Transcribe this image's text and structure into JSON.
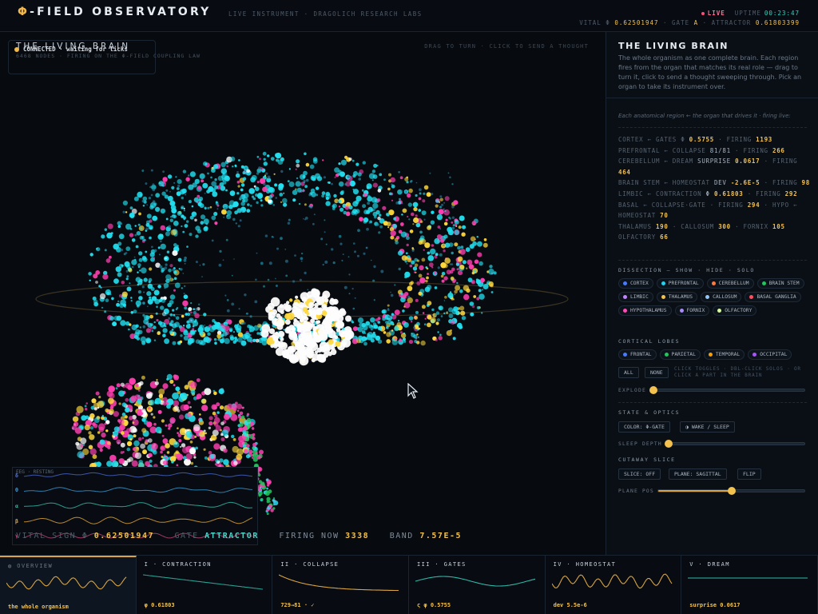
{
  "header": {
    "logo_symbol": "Φ",
    "logo_text": "-FIELD OBSERVATORY",
    "subtitle": "LIVE INSTRUMENT · DRAGOLICH RESEARCH LABS",
    "live_label": "LIVE",
    "uptime_label": "UPTIME",
    "uptime_value": "00:23:47",
    "vital_label": "VITAL Φ",
    "vital_value": "0.62501947",
    "gate_label": "· GATE",
    "gate_value": "A",
    "attractor_label": "· ATTRACTOR",
    "attractor_value": "0.61803399"
  },
  "viewport": {
    "title": "THE LIVING BRAIN",
    "connection_status": "CONNECTED · waiting for ticks",
    "nodes_text": "6468 NODES · FIRING ON THE Φ-FIELD COUPLING LAW",
    "drag_hint": "DRAG TO TURN · CLICK TO SEND A THOUGHT",
    "eeg_label": "EEG · RESTING",
    "eeg_letters": [
      "δ",
      "θ",
      "α",
      "β",
      "γ"
    ],
    "vital_sign_label": "VITAL SIGN Φ",
    "vital_sign_value": "0.62501947",
    "gate_label": "GATE",
    "gate_value": "ATTRACTOR",
    "firing_label": "FIRING NOW",
    "firing_value": "3338",
    "band_label": "BAND",
    "band_value": "7.57E-5"
  },
  "panel": {
    "title": "THE LIVING BRAIN",
    "description": "The whole organism as one complete brain. Each region fires from the organ that matches its real role — drag to turn it, click to send a thought sweeping through. Pick an organ to take its instrument over.",
    "note": "Each anatomical region ← the organ that drives it · firing live:",
    "metrics": {
      "cortex": "CORTEX ← GATES Φ",
      "cortex_phi": "0.5755",
      "cortex_firing_label": "· FIRING",
      "cortex_firing": "1193",
      "prefrontal": "PREFRONTAL ← COLLAPSE",
      "prefrontal_val": "81/81",
      "prefrontal_firing_label": "· FIRING",
      "prefrontal_firing": "266",
      "cerebellum": "CEREBELLUM ← DREAM",
      "cerebellum_surprise_label": "SURPRISE",
      "cerebellum_surprise": "0.0617",
      "cerebellum_firing_label": "· FIRING",
      "cerebellum_firing": "464",
      "brainstem": "BRAIN STEM ← HOMEOSTAT",
      "brainstem_dev_label": "DEV",
      "brainstem_dev": "-2.6E-5",
      "brainstem_firing_label": "· FIRING",
      "brainstem_firing": "98",
      "limbic": "LIMBIC ← CONTRACTION",
      "limbic_phi_label": "Φ",
      "limbic_phi": "0.61803",
      "limbic_firing_label": "· FIRING",
      "limbic_firing": "292",
      "basal": "BASAL ← COLLAPSE·GATE · FIRING",
      "basal_firing": "294",
      "hypo": "HYPO ←",
      "hypo_homeostat": "HOMEOSTAT",
      "hypo_val": "70",
      "thalamus_label": "THALAMUS",
      "thalamus_val": "190",
      "callosum_label": "CALLOSUM",
      "callosum_val": "300",
      "fornix_label": "FORNIX",
      "fornix_val": "105",
      "olfactory_label": "OLFACTORY",
      "olfactory_val": "66"
    },
    "dissection_title": "DISSECTION — SHOW · HIDE · SOLO",
    "regions": [
      {
        "label": "CORTEX",
        "color": "#4a7bff"
      },
      {
        "label": "PREFRONTAL",
        "color": "#22d3ee"
      },
      {
        "label": "CEREBELLUM",
        "color": "#ff7a3d"
      },
      {
        "label": "BRAIN STEM",
        "color": "#22c55e"
      },
      {
        "label": "LIMBIC",
        "color": "#c084fc"
      },
      {
        "label": "THALAMUS",
        "color": "#f2c14e"
      },
      {
        "label": "CALLOSUM",
        "color": "#93c5fd"
      },
      {
        "label": "BASAL GANGLIA",
        "color": "#ff4d5e"
      },
      {
        "label": "HYPOTHALAMUS",
        "color": "#ff4db8"
      },
      {
        "label": "FORNIX",
        "color": "#a78bfa"
      },
      {
        "label": "OLFACTORY",
        "color": "#d9f99d"
      }
    ],
    "lobes_title": "CORTICAL LOBES",
    "lobes": [
      {
        "label": "FRONTAL",
        "color": "#4a7bff"
      },
      {
        "label": "PARIETAL",
        "color": "#22c55e"
      },
      {
        "label": "TEMPORAL",
        "color": "#f59e0b"
      },
      {
        "label": "OCCIPITAL",
        "color": "#a855f7"
      }
    ],
    "all_label": "ALL",
    "none_label": "NONE",
    "toggle_hint": "CLICK TOGGLES · DBL-CLICK SOLOS · OR CLICK A PART IN THE BRAIN",
    "explode_label": "EXPLODE",
    "explode_value": 0,
    "state_title": "STATE & OPTICS",
    "color_btn": "COLOR: Φ-GATE",
    "wake_btn": "◑ WAKE / SLEEP",
    "sleep_label": "SLEEP DEPTH",
    "sleep_value": 0,
    "cutaway_title": "CUTAWAY SLICE",
    "slice_btn": "SLICE: OFF",
    "plane_btn": "PLANE: SAGITTAL",
    "flip_btn": "FLIP",
    "plane_pos_label": "PLANE POS",
    "plane_pos_value": 0.5
  },
  "modes": [
    {
      "title": "◍ OVERVIEW",
      "value": "the whole organism",
      "active": true,
      "color": "#d9a441"
    },
    {
      "title": "I · CONTRACTION",
      "value": "φ 0.61803",
      "active": false,
      "color": "#2a9d8f"
    },
    {
      "title": "II · COLLAPSE",
      "value": "729→81 · ✓",
      "active": false,
      "color": "#d9a441"
    },
    {
      "title": "III · GATES",
      "value": "ς φ 0.5755",
      "active": false,
      "color": "#2fb9a8"
    },
    {
      "title": "IV · HOMEOSTAT",
      "value": "dev 5.5e-6",
      "active": false,
      "color": "#d9a441"
    },
    {
      "title": "V · DREAM",
      "value": "surprise 0.0617",
      "active": false,
      "color": "#2fb9a8"
    }
  ],
  "colors": {
    "accent_gold": "#f2c14e",
    "accent_teal": "#4fd1c5",
    "live_red": "#ff4d7a",
    "cyan_node": "#22e0f0",
    "magenta_node": "#ff3fb0",
    "yellow_node": "#ffd93d"
  }
}
